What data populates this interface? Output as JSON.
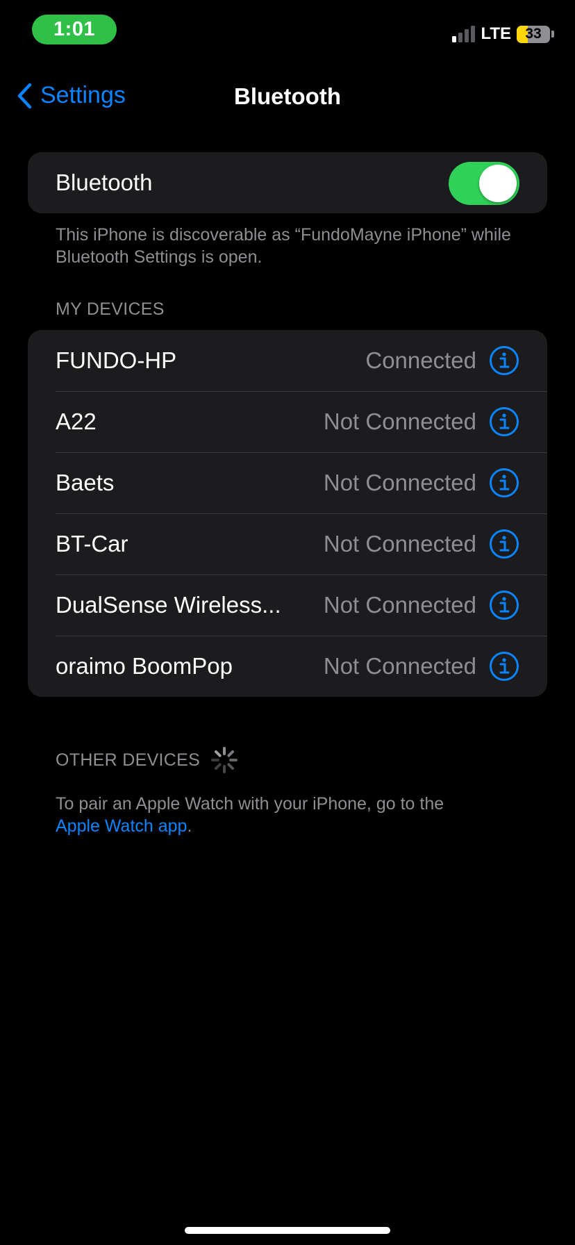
{
  "status_bar": {
    "time": "1:01",
    "network": "LTE",
    "battery": "33",
    "battery_level": 0.33,
    "signal_bars_active": 1,
    "signal_bars_total": 4
  },
  "nav": {
    "back_label": "Settings",
    "title": "Bluetooth"
  },
  "bluetooth": {
    "label": "Bluetooth",
    "enabled": true,
    "discoverable_note": "This iPhone is discoverable as “FundoMayne iPhone” while Bluetooth Settings is open."
  },
  "my_devices": {
    "header": "MY DEVICES",
    "items": [
      {
        "name": "FUNDO-HP",
        "status": "Connected"
      },
      {
        "name": "A22",
        "status": "Not Connected"
      },
      {
        "name": "Baets",
        "status": "Not Connected"
      },
      {
        "name": "BT-Car",
        "status": "Not Connected"
      },
      {
        "name": "DualSense Wireless...",
        "status": "Not Connected"
      },
      {
        "name": "oraimo BoomPop",
        "status": "Not Connected"
      }
    ]
  },
  "other_devices": {
    "header": "OTHER DEVICES",
    "note_prefix": "To pair an Apple Watch with your iPhone, go to the",
    "note_link": "Apple Watch app",
    "note_suffix": "."
  },
  "colors": {
    "accent": "#0a84ff",
    "toggle_on": "#30d158",
    "time_pill": "#30c048",
    "battery_fill": "#ffd60a",
    "background": "#000000",
    "group_background": "#1c1c1e"
  }
}
